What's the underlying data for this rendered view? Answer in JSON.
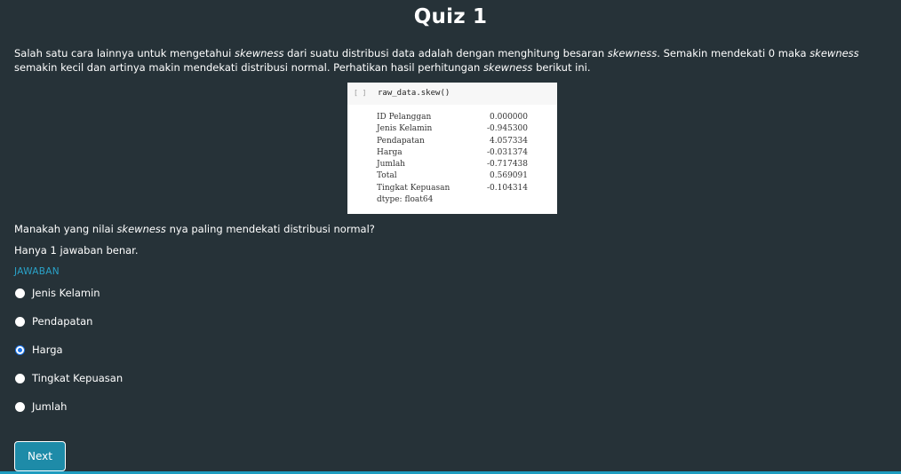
{
  "title": "Quiz 1",
  "intro": {
    "part1": "Salah satu cara lainnya untuk mengetahui ",
    "term1": "skewness",
    "part2": " dari suatu distribusi data adalah dengan menghitung besaran ",
    "term2": "skewness",
    "part3": ". Semakin mendekati 0 maka ",
    "term3": "skewness",
    "part4": " semakin kecil dan artinya makin mendekati distribusi normal. Perhatikan hasil perhitungan ",
    "term4": "skewness",
    "part5": " berikut ini."
  },
  "code": {
    "bracket": "[ ]",
    "command": "raw_data.skew()",
    "rows": [
      {
        "name": "ID Pelanggan",
        "value": "0.000000"
      },
      {
        "name": "Jenis Kelamin",
        "value": "-0.945300"
      },
      {
        "name": "Pendapatan",
        "value": "4.057334"
      },
      {
        "name": "Harga",
        "value": "-0.031374"
      },
      {
        "name": "Jumlah",
        "value": "-0.717438"
      },
      {
        "name": "Total",
        "value": "0.569091"
      },
      {
        "name": "Tingkat Kepuasan",
        "value": "-0.104314"
      }
    ],
    "dtype": "dtype: float64"
  },
  "question": {
    "part1": "Manakah yang nilai ",
    "term": "skewness",
    "part2": " nya paling mendekati distribusi normal?"
  },
  "hint": "Hanya 1 jawaban benar.",
  "answer_label": "JAWABAN",
  "options": [
    {
      "label": "Jenis Kelamin",
      "selected": false
    },
    {
      "label": "Pendapatan",
      "selected": false
    },
    {
      "label": "Harga",
      "selected": true
    },
    {
      "label": "Tingkat Kepuasan",
      "selected": false
    },
    {
      "label": "Jumlah",
      "selected": false
    }
  ],
  "next_label": "Next",
  "colors": {
    "background": "#263238",
    "accent": "#1e8ba8",
    "answer_label": "#2aa3c9",
    "radio_selected": "#1a73e8"
  }
}
